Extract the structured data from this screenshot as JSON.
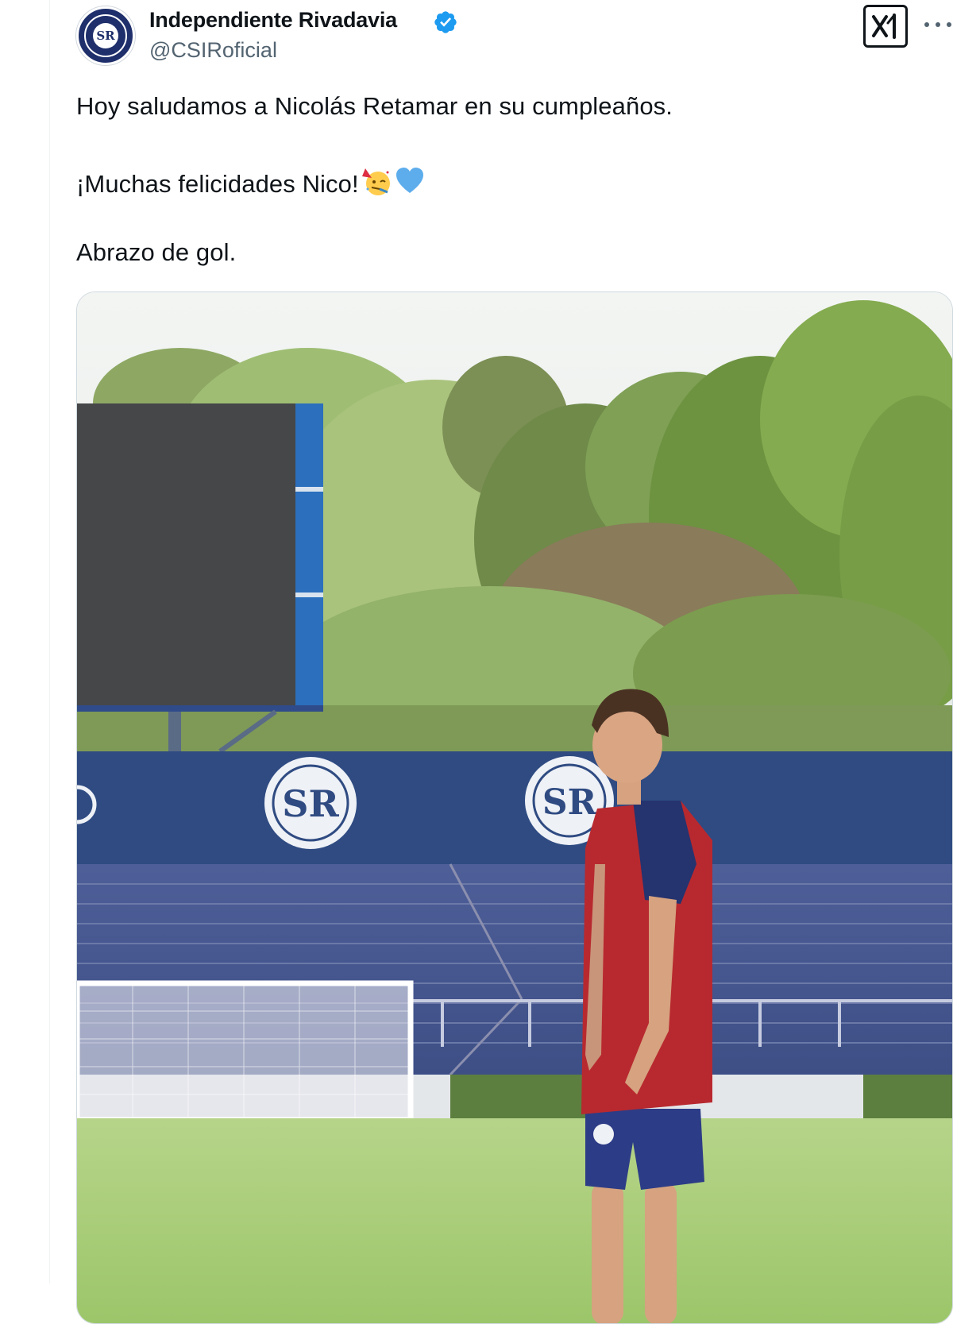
{
  "account": {
    "display_name": "Independiente Rivadavia",
    "handle": "@CSIRoficial",
    "verified": true,
    "avatar_monogram": "SR"
  },
  "tweet": {
    "line1": "Hoy saludamos a Nicolás Retamar en su cumpleaños.",
    "line2": "¡Muchas felicidades Nico!",
    "line2_emojis": [
      "partying-face-emoji",
      "blue-heart-emoji"
    ],
    "line3": "Abrazo de gol."
  },
  "actions": {
    "grok_label": "Grok",
    "more_label": "More"
  },
  "colors": {
    "verified_blue": "#1d9bf0",
    "club_navy": "#1f2f6b",
    "text_primary": "#0f1419",
    "text_secondary": "#536471"
  },
  "media": {
    "type": "photo",
    "description_icons": [
      "stadium-photo",
      "player-in-training-bib"
    ]
  }
}
